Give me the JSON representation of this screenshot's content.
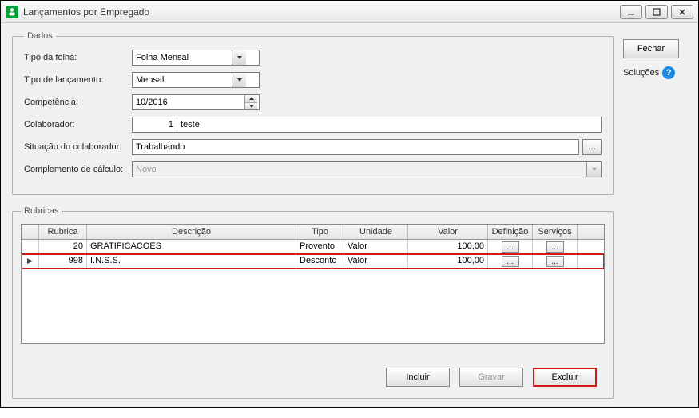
{
  "window": {
    "title": "Lançamentos por Empregado"
  },
  "sidebar": {
    "close_label": "Fechar",
    "solutions_label": "Soluções"
  },
  "dados": {
    "legend": "Dados",
    "tipo_folha_label": "Tipo da folha:",
    "tipo_folha_value": "Folha Mensal",
    "tipo_lancamento_label": "Tipo de lançamento:",
    "tipo_lancamento_value": "Mensal",
    "competencia_label": "Competência:",
    "competencia_value": "10/2016",
    "colaborador_label": "Colaborador:",
    "colaborador_id": "1",
    "colaborador_nome": "teste",
    "situacao_label": "Situação do colaborador:",
    "situacao_value": "Trabalhando",
    "complemento_label": "Complemento de cálculo:",
    "complemento_value": "Novo"
  },
  "rubricas": {
    "legend": "Rubricas",
    "headers": {
      "rubrica": "Rubrica",
      "descricao": "Descrição",
      "tipo": "Tipo",
      "unidade": "Unidade",
      "valor": "Valor",
      "definicao": "Definição",
      "servicos": "Serviços"
    },
    "rows": [
      {
        "rubrica": "20",
        "descricao": "GRATIFICACOES",
        "tipo": "Provento",
        "unidade": "Valor",
        "valor": "100,00",
        "highlight": false,
        "current": false
      },
      {
        "rubrica": "998",
        "descricao": "I.N.S.S.",
        "tipo": "Desconto",
        "unidade": "Valor",
        "valor": "100,00",
        "highlight": true,
        "current": true
      }
    ],
    "buttons": {
      "incluir": "Incluir",
      "gravar": "Gravar",
      "excluir": "Excluir"
    },
    "dots": "..."
  }
}
